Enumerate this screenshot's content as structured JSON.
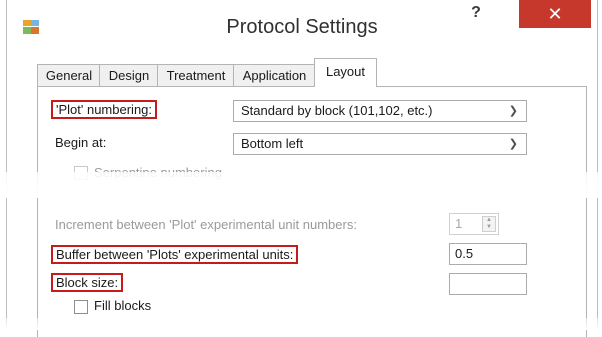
{
  "window": {
    "title": "Protocol Settings",
    "help_label": "?",
    "close_label": "✕"
  },
  "tabs": [
    {
      "label": "General"
    },
    {
      "label": "Design"
    },
    {
      "label": "Treatment"
    },
    {
      "label": "Application"
    },
    {
      "label": "Layout",
      "active": true
    }
  ],
  "layout": {
    "plot_numbering_label": "'Plot' numbering:",
    "plot_numbering_value": "Standard by block (101,102, etc.)",
    "begin_at_label": "Begin at:",
    "begin_at_value": "Bottom left",
    "serpentine_label": "Serpentine numbering",
    "increment_label": "Increment between 'Plot' experimental unit numbers:",
    "increment_value": "1",
    "buffer_label": "Buffer between 'Plots' experimental units:",
    "buffer_value": "0.5",
    "block_size_label": "Block size:",
    "block_size_value": "",
    "fill_blocks_label": "Fill blocks"
  },
  "colors": {
    "highlight": "#c51b1b",
    "close_button": "#c6382c"
  },
  "icons": {
    "app": "app-grid-icon",
    "dropdown": "chevron-down-icon",
    "spinner": "spinner-arrows-icon"
  }
}
